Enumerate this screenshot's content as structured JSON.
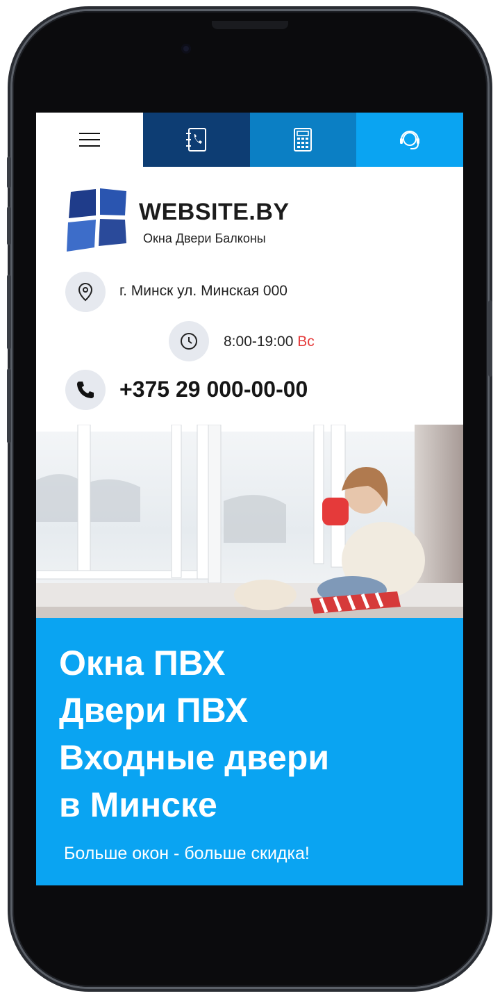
{
  "topbar": {
    "items": [
      {
        "name": "menu-icon",
        "color": "#ffffff"
      },
      {
        "name": "phone-book-icon",
        "color": "#0d3d73"
      },
      {
        "name": "calculator-icon",
        "color": "#0b7fc4"
      },
      {
        "name": "support-headset-icon",
        "color": "#0aa4f2"
      }
    ]
  },
  "brand": {
    "title": "WEBSITE.BY",
    "subtitle": "Окна Двери Балконы"
  },
  "contacts": {
    "address": "г. Минск ул. Минская 000",
    "hours": "8:00-19:00",
    "day_off": "Вс",
    "phone": "+375 29 000-00-00"
  },
  "hero": {
    "headline": [
      "Окна ПВХ",
      "Двери ПВХ",
      "Входные двери",
      "в Минске"
    ],
    "tagline": "Больше окон - больше скидка!"
  },
  "colors": {
    "accent": "#0aa4f2",
    "dark_blue": "#0d3d73",
    "mid_blue": "#0b7fc4",
    "red": "#e53a3a"
  }
}
